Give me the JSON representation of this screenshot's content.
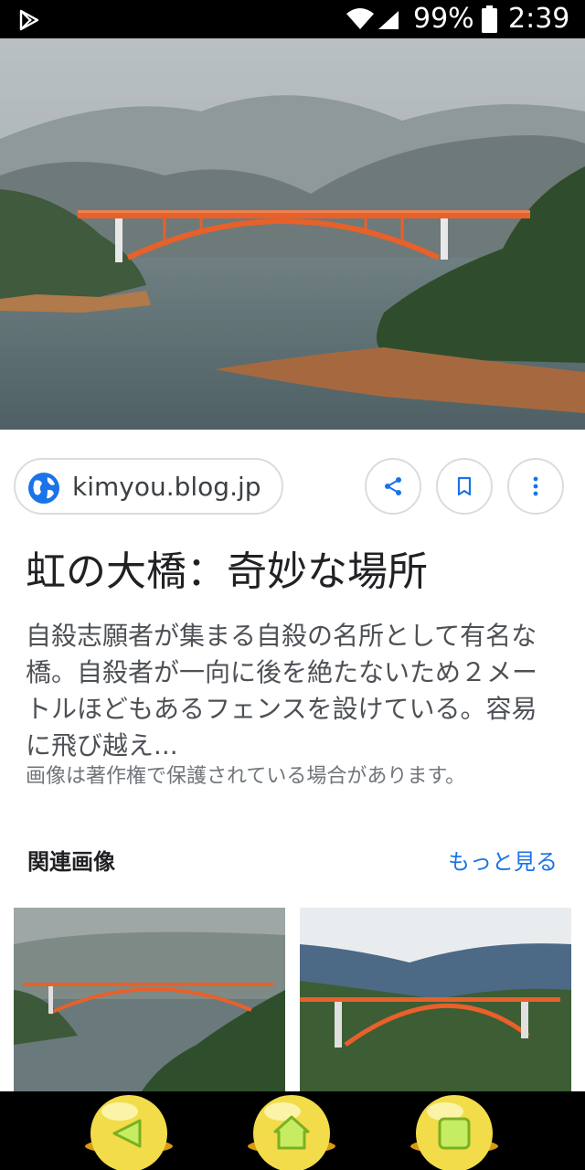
{
  "status_bar": {
    "battery_percent": "99%",
    "time": "2:39"
  },
  "result": {
    "source_domain": "kimyou.blog.jp",
    "title": "虹の大橋：奇妙な場所",
    "description": "自殺志願者が集まる自殺の名所として有名な橋。自殺者が一向に後を絶たないため２メートルほどもあるフェンスを設けている。容易に飛び越え...",
    "copyright_notice": "画像は著作権で保護されている場合があります。"
  },
  "related": {
    "heading": "関連画像",
    "see_more_label": "もっと見る"
  },
  "icons": {
    "share": "share-icon",
    "bookmark": "bookmark-icon",
    "more": "more-vert-icon",
    "globe": "globe-icon"
  },
  "colors": {
    "link_blue": "#1a73e8",
    "bridge_orange": "#e8602a"
  }
}
